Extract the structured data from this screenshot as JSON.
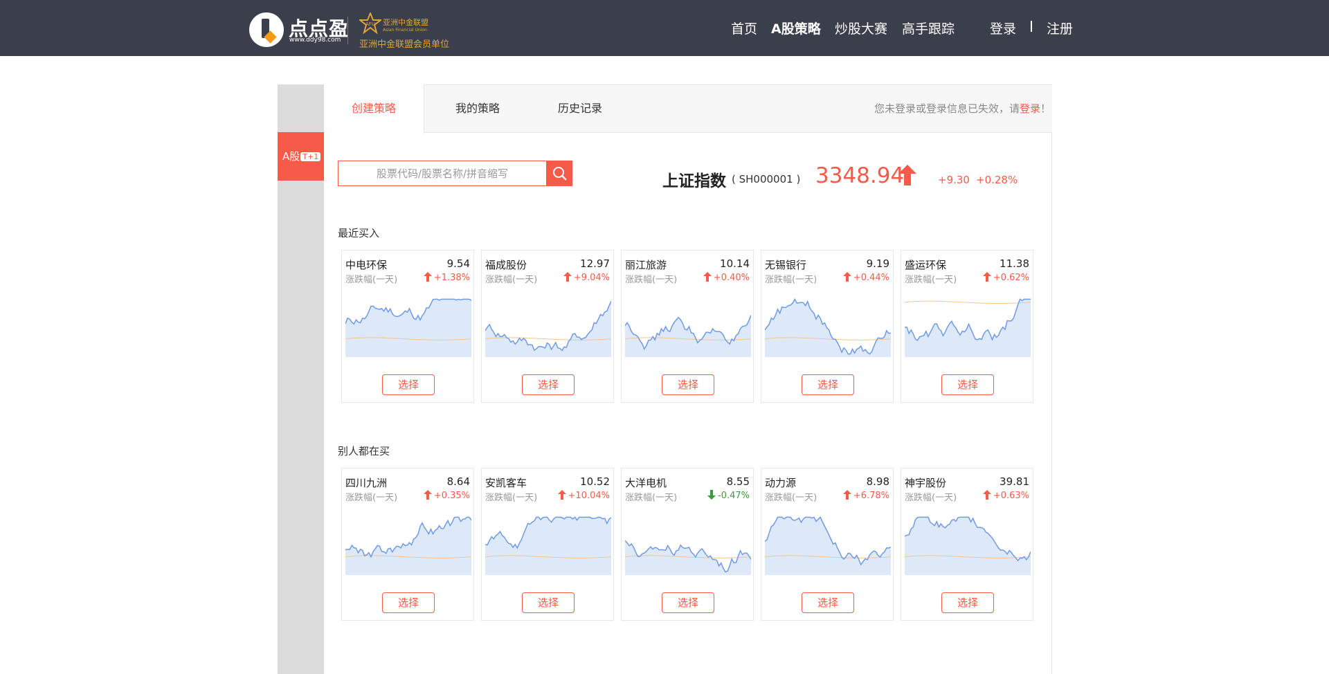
{
  "header": {
    "brand": "点点盈",
    "brand_url": "www.ddy98.com",
    "afu_name": "亚洲中金联盟",
    "afu_en": "Asian Financial Union",
    "afu_member": "亚洲中金联盟会员单位",
    "nav": [
      "首页",
      "A股策略",
      "炒股大赛",
      "高手跟踪"
    ],
    "login": "登录",
    "register": "注册"
  },
  "sidebar": {
    "label": "A股",
    "badge": "T+1"
  },
  "tabs": [
    "创建策略",
    "我的策略",
    "历史记录"
  ],
  "login_hint": {
    "prefix": "您未登录或登录信息已失效，请",
    "link": "登录",
    "suffix": "！"
  },
  "search": {
    "placeholder": "股票代码/股票名称/拼音缩写"
  },
  "index": {
    "name": "上证指数",
    "code": "( SH000001 )",
    "value": "3348.94",
    "change": "+9.30",
    "pct": "+0.28%"
  },
  "sections": {
    "recent": "最近买入",
    "others": "别人都在买"
  },
  "card_sub": "涨跌幅(一天)",
  "select_label": "选择",
  "recent_stocks": [
    {
      "name": "中电环保",
      "price": "9.54",
      "change": "+1.38%",
      "dir": "up"
    },
    {
      "name": "福成股份",
      "price": "12.97",
      "change": "+9.04%",
      "dir": "up"
    },
    {
      "name": "丽江旅游",
      "price": "10.14",
      "change": "+0.40%",
      "dir": "up"
    },
    {
      "name": "无锡银行",
      "price": "9.19",
      "change": "+0.44%",
      "dir": "up"
    },
    {
      "name": "盛运环保",
      "price": "11.38",
      "change": "+0.62%",
      "dir": "up"
    }
  ],
  "other_stocks": [
    {
      "name": "四川九洲",
      "price": "8.64",
      "change": "+0.35%",
      "dir": "up"
    },
    {
      "name": "安凯客车",
      "price": "10.52",
      "change": "+10.04%",
      "dir": "up"
    },
    {
      "name": "大洋电机",
      "price": "8.55",
      "change": "-0.47%",
      "dir": "down"
    },
    {
      "name": "动力源",
      "price": "8.98",
      "change": "+6.78%",
      "dir": "up"
    },
    {
      "name": "神宇股份",
      "price": "39.81",
      "change": "+0.63%",
      "dir": "up"
    }
  ],
  "colors": {
    "accent": "#f65a49",
    "header_bg": "#3a3f4b",
    "up": "#f65a49",
    "down": "#3b9b3b",
    "spark_line": "#6f9be6",
    "spark_fill": "#dde8f8",
    "avg_line": "#f3c58f"
  }
}
